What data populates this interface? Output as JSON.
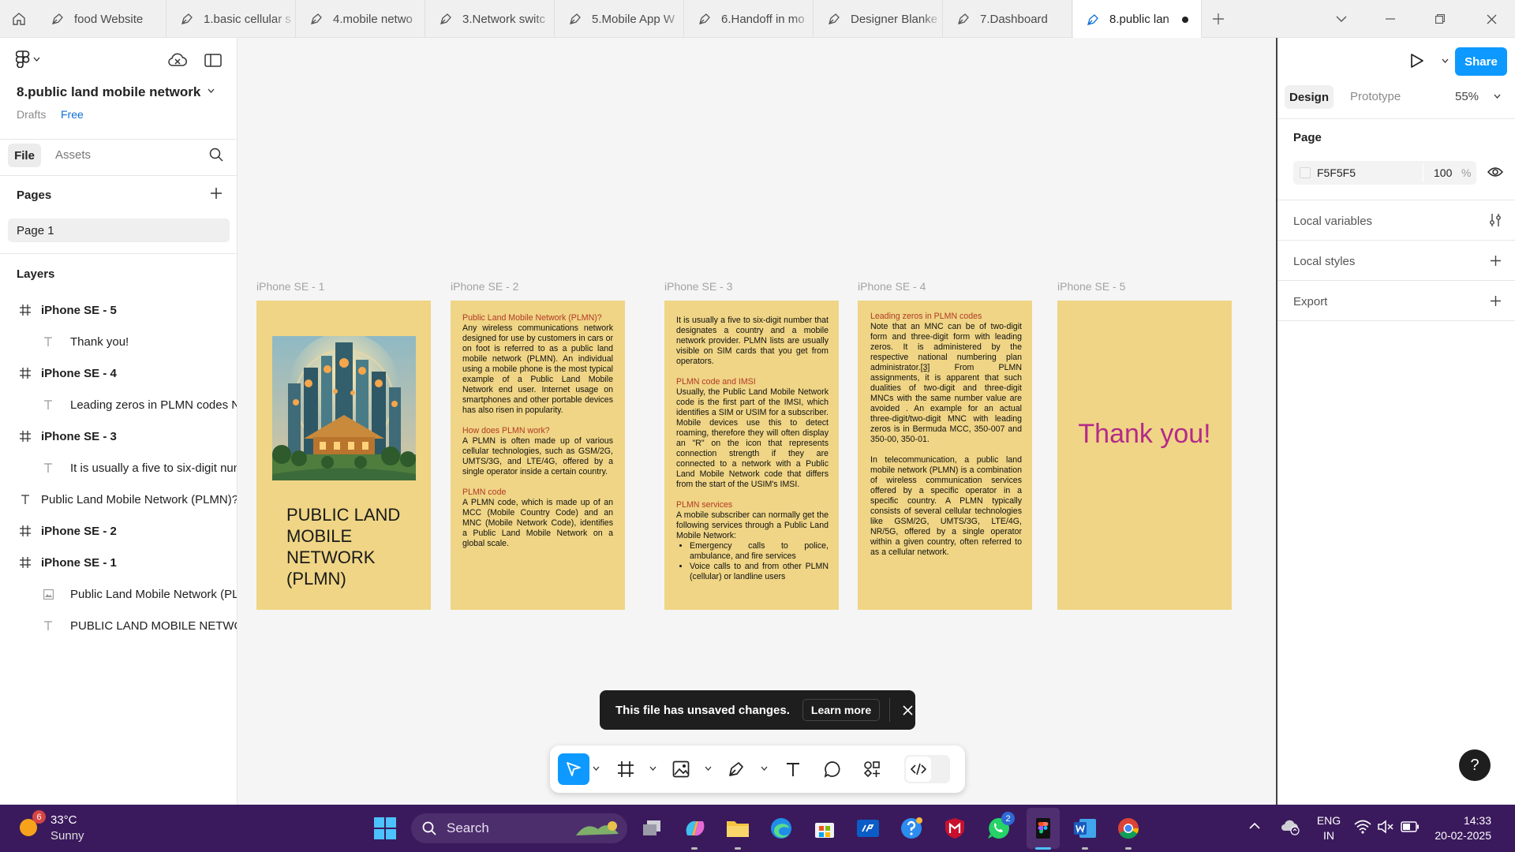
{
  "tabs": [
    {
      "label": "food Website"
    },
    {
      "label": "1.basic cellular s"
    },
    {
      "label": "4.mobile netwo"
    },
    {
      "label": "3.Network switc"
    },
    {
      "label": "5.Mobile App W"
    },
    {
      "label": "6.Handoff in mo"
    },
    {
      "label": "Designer Blanke"
    },
    {
      "label": "7.Dashboard"
    },
    {
      "label": "8.public lan"
    }
  ],
  "file": {
    "name": "8.public land mobile network",
    "location": "Drafts",
    "plan": "Free"
  },
  "left_tabs": {
    "file": "File",
    "assets": "Assets"
  },
  "pages": {
    "heading": "Pages",
    "items": [
      "Page 1"
    ]
  },
  "layers": {
    "heading": "Layers",
    "items": [
      {
        "label": "iPhone SE - 5",
        "type": "frame"
      },
      {
        "label": "Thank you!",
        "type": "text"
      },
      {
        "label": "iPhone SE - 4",
        "type": "frame"
      },
      {
        "label": "Leading zeros in PLMN codes Not",
        "type": "text"
      },
      {
        "label": "iPhone SE - 3",
        "type": "frame"
      },
      {
        "label": "It is usually a five to six-digit num",
        "type": "text"
      },
      {
        "label": "Public Land Mobile Network (PLMN)? A",
        "type": "text-top"
      },
      {
        "label": "iPhone SE - 2",
        "type": "frame"
      },
      {
        "label": "iPhone SE - 1",
        "type": "frame"
      },
      {
        "label": "Public Land Mobile Network (PLM",
        "type": "image"
      },
      {
        "label": "PUBLIC LAND MOBILE NETWORK",
        "type": "text"
      }
    ]
  },
  "frames": [
    {
      "label": "iPhone SE - 1",
      "title": "PUBLIC LAND MOBILE NETWORK (PLMN)"
    },
    {
      "label": "iPhone SE - 2",
      "h1": "Public Land Mobile Network (PLMN)?",
      "p1": "Any wireless communications network designed for use by customers in cars or on foot is referred to as a public land mobile network (PLMN). An individual using a mobile phone is the most typical example of a Public Land Mobile Network end user. Internet usage on smartphones and other portable devices has also risen in popularity.",
      "h2": "How does PLMN work?",
      "p2": "A PLMN is often made up of various cellular technologies, such as GSM/2G, UMTS/3G, and LTE/4G, offered by a single operator inside a certain country.",
      "h3": "PLMN code",
      "p3": "A PLMN code, which is made up of an MCC (Mobile Country Code) and an MNC (Mobile Network Code), identifies a Public Land Mobile Network on a global scale."
    },
    {
      "label": "iPhone SE - 3",
      "p1": "It is usually a five to six-digit number that designates a country and a mobile network provider. PLMN lists are usually visible on SIM cards that you get from operators.",
      "h1": "PLMN code and IMSI",
      "p2": "Usually, the Public Land Mobile Network code is the first part of the IMSI, which identifies a SIM or USIM for a subscriber. Mobile devices use this to detect roaming, therefore they will often display an \"R\" on the icon that represents connection strength if they are connected to a network with a Public Land Mobile Network code that differs from the start of the USIM's IMSI.",
      "h2": "PLMN services",
      "p3": "A mobile subscriber can normally get the following services through a Public Land Mobile Network:",
      "bullets": [
        "Emergency calls to police, ambulance, and fire services",
        "Voice calls to and from other PLMN (cellular) or landline users"
      ]
    },
    {
      "label": "iPhone SE - 4",
      "h1": "Leading zeros in PLMN codes",
      "p1a": "Note that an MNC can be of two-digit form and three-digit form with leading zeros. It is administered by the respective national numbering plan administrator.",
      "ref": "[3]",
      "p1b": " From PLMN assignments, it is apparent that such dualities of two-digit and three-digit MNCs with the same number value are avoided . An example for an actual three-digit/two-digit MNC with leading zeros is in Bermuda MCC, 350-007 and 350-00, 350-01.",
      "p2": "In telecommunication, a public land mobile network (PLMN) is a combination of wireless communication services offered by a specific operator in a specific country. A PLMN typically consists of several cellular technologies like GSM/2G, UMTS/3G, LTE/4G, NR/5G, offered by a single operator within a given country, often referred to as a cellular network."
    },
    {
      "label": "iPhone SE - 5",
      "text": "Thank you!"
    }
  ],
  "toast": {
    "message": "This file has unsaved changes.",
    "action": "Learn more"
  },
  "right_panel": {
    "tabs": {
      "design": "Design",
      "prototype": "Prototype"
    },
    "zoom": "55%",
    "share": "Share",
    "page_heading": "Page",
    "page_color": "F5F5F5",
    "opacity": "100",
    "opacity_unit": "%",
    "local_variables": "Local variables",
    "local_styles": "Local styles",
    "export": "Export",
    "help": "?"
  },
  "taskbar": {
    "weather_temp": "33°C",
    "weather_desc": "Sunny",
    "weather_badge": "6",
    "search": "Search",
    "whatsapp_badge": "2",
    "lang1": "ENG",
    "lang2": "IN",
    "time": "14:33",
    "date": "20-02-2025"
  },
  "colors": {
    "frame_bg": "#efd585",
    "heading_red": "#b33a26",
    "thank_you": "#b42a8a",
    "accent": "#0d99ff",
    "taskbar": "#3a1a5c"
  }
}
